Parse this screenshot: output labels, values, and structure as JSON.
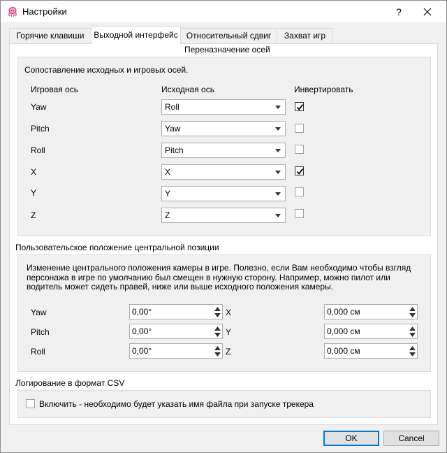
{
  "window": {
    "title": "Настройки",
    "help_label": "?"
  },
  "tabs": [
    {
      "label": "Горячие клавиши"
    },
    {
      "label": "Выходной интерфейс"
    },
    {
      "label": "Относительный сдвиг"
    },
    {
      "label": "Захват игр"
    }
  ],
  "axis_remap": {
    "section_title": "Переназначение осей",
    "description": "Сопоставление исходных и игровых осей.",
    "headers": {
      "game_axis": "Игровая ось",
      "source_axis": "Исходная ось",
      "invert": "Инвертировать"
    },
    "rows": [
      {
        "game_axis": "Yaw",
        "source_axis": "Roll",
        "inverted": true
      },
      {
        "game_axis": "Pitch",
        "source_axis": "Yaw",
        "inverted": false
      },
      {
        "game_axis": "Roll",
        "source_axis": "Pitch",
        "inverted": false
      },
      {
        "game_axis": "X",
        "source_axis": "X",
        "inverted": true
      },
      {
        "game_axis": "Y",
        "source_axis": "Y",
        "inverted": false
      },
      {
        "game_axis": "Z",
        "source_axis": "Z",
        "inverted": false
      }
    ]
  },
  "center_position": {
    "section_title": "Пользовательское положение центральной позиции",
    "description": "Изменение центрального положения камеры в игре. Полезно, если Вам необходимо чтобы взгляд персонажа в игре по умолчанию был смещен в нужную сторону. Например, можно пилот или водитель может сидеть правей, ниже или выше исходного положения камеры.",
    "rotation": [
      {
        "label": "Yaw",
        "value": "0,00°"
      },
      {
        "label": "Pitch",
        "value": "0,00°"
      },
      {
        "label": "Roll",
        "value": "0,00°"
      }
    ],
    "translation": [
      {
        "label": "X",
        "value": "0,000 см"
      },
      {
        "label": "Y",
        "value": "0,000 см"
      },
      {
        "label": "Z",
        "value": "0,000 см"
      }
    ]
  },
  "csv_logging": {
    "section_title": "Логирование в формат CSV",
    "enable_label": "Включить - необходимо будет указать имя файла при запуске трекера",
    "enabled": false
  },
  "buttons": {
    "ok": "OK",
    "cancel": "Cancel"
  },
  "colors": {
    "accent": "#0078d7",
    "check": "#000000",
    "icon_pink": "#d6246e"
  },
  "icons": {
    "app": "octopus-icon",
    "close": "close-icon",
    "dropdown": "chevron-down-icon",
    "spin_up": "spin-up-icon",
    "spin_down": "spin-down-icon",
    "check": "check-icon"
  }
}
